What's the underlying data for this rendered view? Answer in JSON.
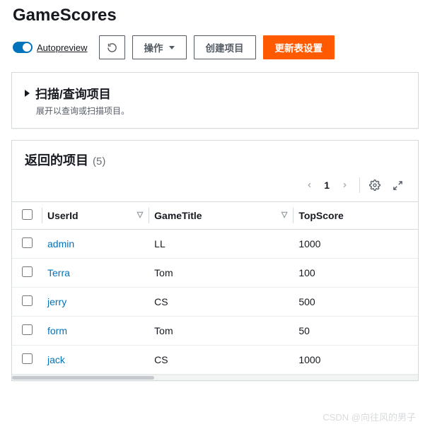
{
  "page_title": "GameScores",
  "toolbar": {
    "autopreview_label": "Autopreview",
    "actions_label": "操作",
    "create_item_label": "创建项目",
    "update_settings_label": "更新表设置"
  },
  "scan_panel": {
    "title": "扫描/查询项目",
    "subtitle": "展开以查询或扫描项目。"
  },
  "results": {
    "title": "返回的项目",
    "count": "(5)",
    "page": "1",
    "columns": {
      "userId": "UserId",
      "gameTitle": "GameTitle",
      "topScore": "TopScore"
    },
    "rows": [
      {
        "userId": "admin",
        "gameTitle": "LL",
        "topScore": "1000"
      },
      {
        "userId": "Terra",
        "gameTitle": "Tom",
        "topScore": "100"
      },
      {
        "userId": "jerry",
        "gameTitle": "CS",
        "topScore": "500"
      },
      {
        "userId": "form",
        "gameTitle": "Tom",
        "topScore": "50"
      },
      {
        "userId": "jack",
        "gameTitle": "CS",
        "topScore": "1000"
      }
    ]
  },
  "watermark": "CSDN @向往风的男子"
}
